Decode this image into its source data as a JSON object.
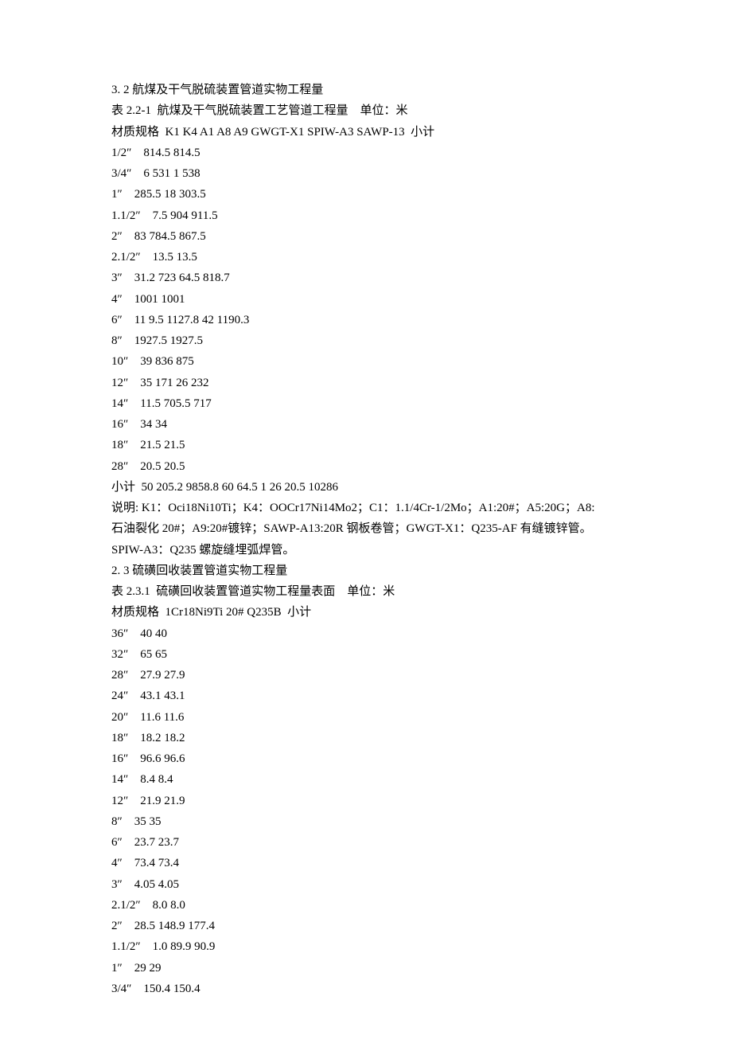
{
  "section_2_2": {
    "heading": "3. 2 航煤及干气脱硫装置管道实物工程量",
    "table_caption": "表 2.2-1  航煤及干气脱硫装置工艺管道工程量    单位：米",
    "header_row": "材质规格  K1 K4 A1 A8 A9 GWGT-X1 SPIW-A3 SAWP-13  小计",
    "rows": [
      "1/2″    814.5 814.5",
      "3/4″    6 531 1 538",
      "1″    285.5 18 303.5",
      "1.1/2″    7.5 904 911.5",
      "2″    83 784.5 867.5",
      "2.1/2″    13.5 13.5",
      "3″    31.2 723 64.5 818.7",
      "4″    1001 1001",
      "6″    11 9.5 1127.8 42 1190.3",
      "8″    1927.5 1927.5",
      "10″    39 836 875",
      "12″    35 171 26 232",
      "14″    11.5 705.5 717",
      "16″    34 34",
      "18″    21.5 21.5",
      "28″    20.5 20.5"
    ],
    "subtotal": "小计  50 205.2 9858.8 60 64.5 1 26 20.5 10286",
    "note_line1": "说明: K1：Oci18Ni10Ti；K4：OOCr17Ni14Mo2；C1：1.1/4Cr-1/2Mo；A1:20#；A5:20G；A8:",
    "note_line2": "石油裂化 20#；A9:20#镀锌；SAWP-A13:20R 钢板卷管；GWGT-X1：Q235-AF 有缝镀锌管。",
    "note_line3": "SPIW-A3：Q235 螺旋缝埋弧焊管。"
  },
  "section_2_3": {
    "heading": "2. 3 硫磺回收装置管道实物工程量",
    "table_caption": "表 2.3.1  硫磺回收装置管道实物工程量表面    单位：米",
    "header_row": "材质规格  1Cr18Ni9Ti 20# Q235B  小计",
    "rows": [
      "36″    40 40",
      "32″    65 65",
      "28″    27.9 27.9",
      "24″    43.1 43.1",
      "20″    11.6 11.6",
      "18″    18.2 18.2",
      "16″    96.6 96.6",
      "14″    8.4 8.4",
      "12″    21.9 21.9",
      "8″    35 35",
      "6″    23.7 23.7",
      "4″    73.4 73.4",
      "3″    4.05 4.05",
      "2.1/2″    8.0 8.0",
      "2″    28.5 148.9 177.4",
      "1.1/2″    1.0 89.9 90.9",
      "1″    29 29",
      "3/4″    150.4 150.4"
    ]
  },
  "chart_data": [
    {
      "type": "table",
      "title": "表 2.2-1 航煤及干气脱硫装置工艺管道工程量",
      "unit": "米",
      "columns": [
        "材质规格",
        "K1",
        "K4",
        "A1",
        "A8",
        "A9",
        "GWGT-X1",
        "SPIW-A3",
        "SAWP-13",
        "小计"
      ],
      "rows": [
        {
          "材质规格": "1/2″",
          "A1": 814.5,
          "小计": 814.5
        },
        {
          "材质规格": "3/4″",
          "A1": 6,
          "A8": 531,
          "A9": 1,
          "小计": 538
        },
        {
          "材质规格": "1″",
          "A1": 285.5,
          "A8": 18,
          "小计": 303.5
        },
        {
          "材质规格": "1.1/2″",
          "A1": 7.5,
          "A8": 904,
          "小计": 911.5
        },
        {
          "材质规格": "2″",
          "A1": 83,
          "A8": 784.5,
          "小计": 867.5
        },
        {
          "材质规格": "2.1/2″",
          "A1": 13.5,
          "小计": 13.5
        },
        {
          "材质规格": "3″",
          "K4": 31.2,
          "A1": 723,
          "A8": 64.5,
          "小计": 818.7
        },
        {
          "材质规格": "4″",
          "A1": 1001,
          "小计": 1001
        },
        {
          "材质规格": "6″",
          "K1": 11,
          "K4": 9.5,
          "A1": 1127.8,
          "A8": 42,
          "小计": 1190.3
        },
        {
          "材质规格": "8″",
          "A1": 1927.5,
          "小计": 1927.5
        },
        {
          "材质规格": "10″",
          "K1": 39,
          "A1": 836,
          "小计": 875
        },
        {
          "材质规格": "12″",
          "K4": 35,
          "A1": 171,
          "A8": 26,
          "小计": 232
        },
        {
          "材质规格": "14″",
          "K4": 11.5,
          "A1": 705.5,
          "小计": 717
        },
        {
          "材质规格": "16″",
          "A1": 34,
          "小计": 34
        },
        {
          "材质规格": "18″",
          "A1": 21.5,
          "小计": 21.5
        },
        {
          "材质规格": "28″",
          "SAWP-13": 20.5,
          "小计": 20.5
        },
        {
          "材质规格": "小计",
          "K1": 50,
          "K4": 205.2,
          "A1": 9858.8,
          "A8": 60,
          "A9": 64.5,
          "GWGT-X1": 1,
          "SPIW-A3": 26,
          "SAWP-13": 20.5,
          "小计": 10286
        }
      ]
    },
    {
      "type": "table",
      "title": "表 2.3.1 硫磺回收装置管道实物工程量表面",
      "unit": "米",
      "columns": [
        "材质规格",
        "1Cr18Ni9Ti",
        "20#",
        "Q235B",
        "小计"
      ],
      "rows": [
        {
          "材质规格": "36″",
          "Q235B": 40,
          "小计": 40
        },
        {
          "材质规格": "32″",
          "Q235B": 65,
          "小计": 65
        },
        {
          "材质规格": "28″",
          "Q235B": 27.9,
          "小计": 27.9
        },
        {
          "材质规格": "24″",
          "Q235B": 43.1,
          "小计": 43.1
        },
        {
          "材质规格": "20″",
          "Q235B": 11.6,
          "小计": 11.6
        },
        {
          "材质规格": "18″",
          "Q235B": 18.2,
          "小计": 18.2
        },
        {
          "材质规格": "16″",
          "20#": 96.6,
          "小计": 96.6
        },
        {
          "材质规格": "14″",
          "20#": 8.4,
          "小计": 8.4
        },
        {
          "材质规格": "12″",
          "20#": 21.9,
          "小计": 21.9
        },
        {
          "材质规格": "8″",
          "20#": 35,
          "小计": 35
        },
        {
          "材质规格": "6″",
          "20#": 23.7,
          "小计": 23.7
        },
        {
          "材质规格": "4″",
          "20#": 73.4,
          "小计": 73.4
        },
        {
          "材质规格": "3″",
          "20#": 4.05,
          "小计": 4.05
        },
        {
          "材质规格": "2.1/2″",
          "20#": 8.0,
          "小计": 8.0
        },
        {
          "材质规格": "2″",
          "1Cr18Ni9Ti": 28.5,
          "20#": 148.9,
          "小计": 177.4
        },
        {
          "材质规格": "1.1/2″",
          "1Cr18Ni9Ti": 1.0,
          "20#": 89.9,
          "小计": 90.9
        },
        {
          "材质规格": "1″",
          "20#": 29,
          "小计": 29
        },
        {
          "材质规格": "3/4″",
          "20#": 150.4,
          "小计": 150.4
        }
      ]
    }
  ]
}
